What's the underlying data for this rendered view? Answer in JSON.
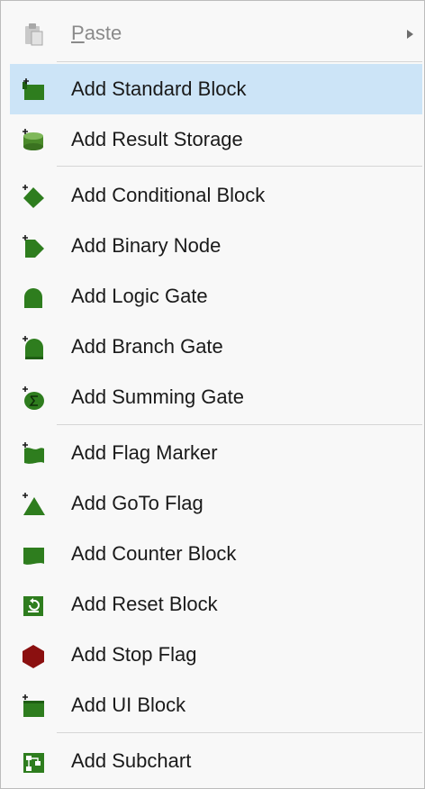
{
  "menu": {
    "paste": {
      "prefix": "",
      "accel": "P",
      "rest": "aste"
    },
    "items": [
      {
        "label": "Add Standard Block",
        "icon": "standard-block-icon"
      },
      {
        "label": "Add Result Storage",
        "icon": "result-storage-icon"
      },
      {
        "label": "Add Conditional Block",
        "icon": "conditional-block-icon"
      },
      {
        "label": "Add Binary Node",
        "icon": "binary-node-icon"
      },
      {
        "label": "Add Logic Gate",
        "icon": "logic-gate-icon"
      },
      {
        "label": "Add Branch Gate",
        "icon": "branch-gate-icon"
      },
      {
        "label": "Add Summing Gate",
        "icon": "summing-gate-icon"
      },
      {
        "label": "Add Flag Marker",
        "icon": "flag-marker-icon"
      },
      {
        "label": "Add GoTo Flag",
        "icon": "goto-flag-icon"
      },
      {
        "label": "Add Counter Block",
        "icon": "counter-block-icon"
      },
      {
        "label": "Add Reset Block",
        "icon": "reset-block-icon"
      },
      {
        "label": "Add Stop Flag",
        "icon": "stop-flag-icon"
      },
      {
        "label": "Add UI Block",
        "icon": "ui-block-icon"
      },
      {
        "label": "Add Subchart",
        "icon": "subchart-icon"
      }
    ]
  },
  "colors": {
    "highlight": "#cce4f7",
    "icon_green": "#2e7d1e",
    "icon_dark_green": "#1f5e14",
    "stop_red": "#8b1010"
  }
}
